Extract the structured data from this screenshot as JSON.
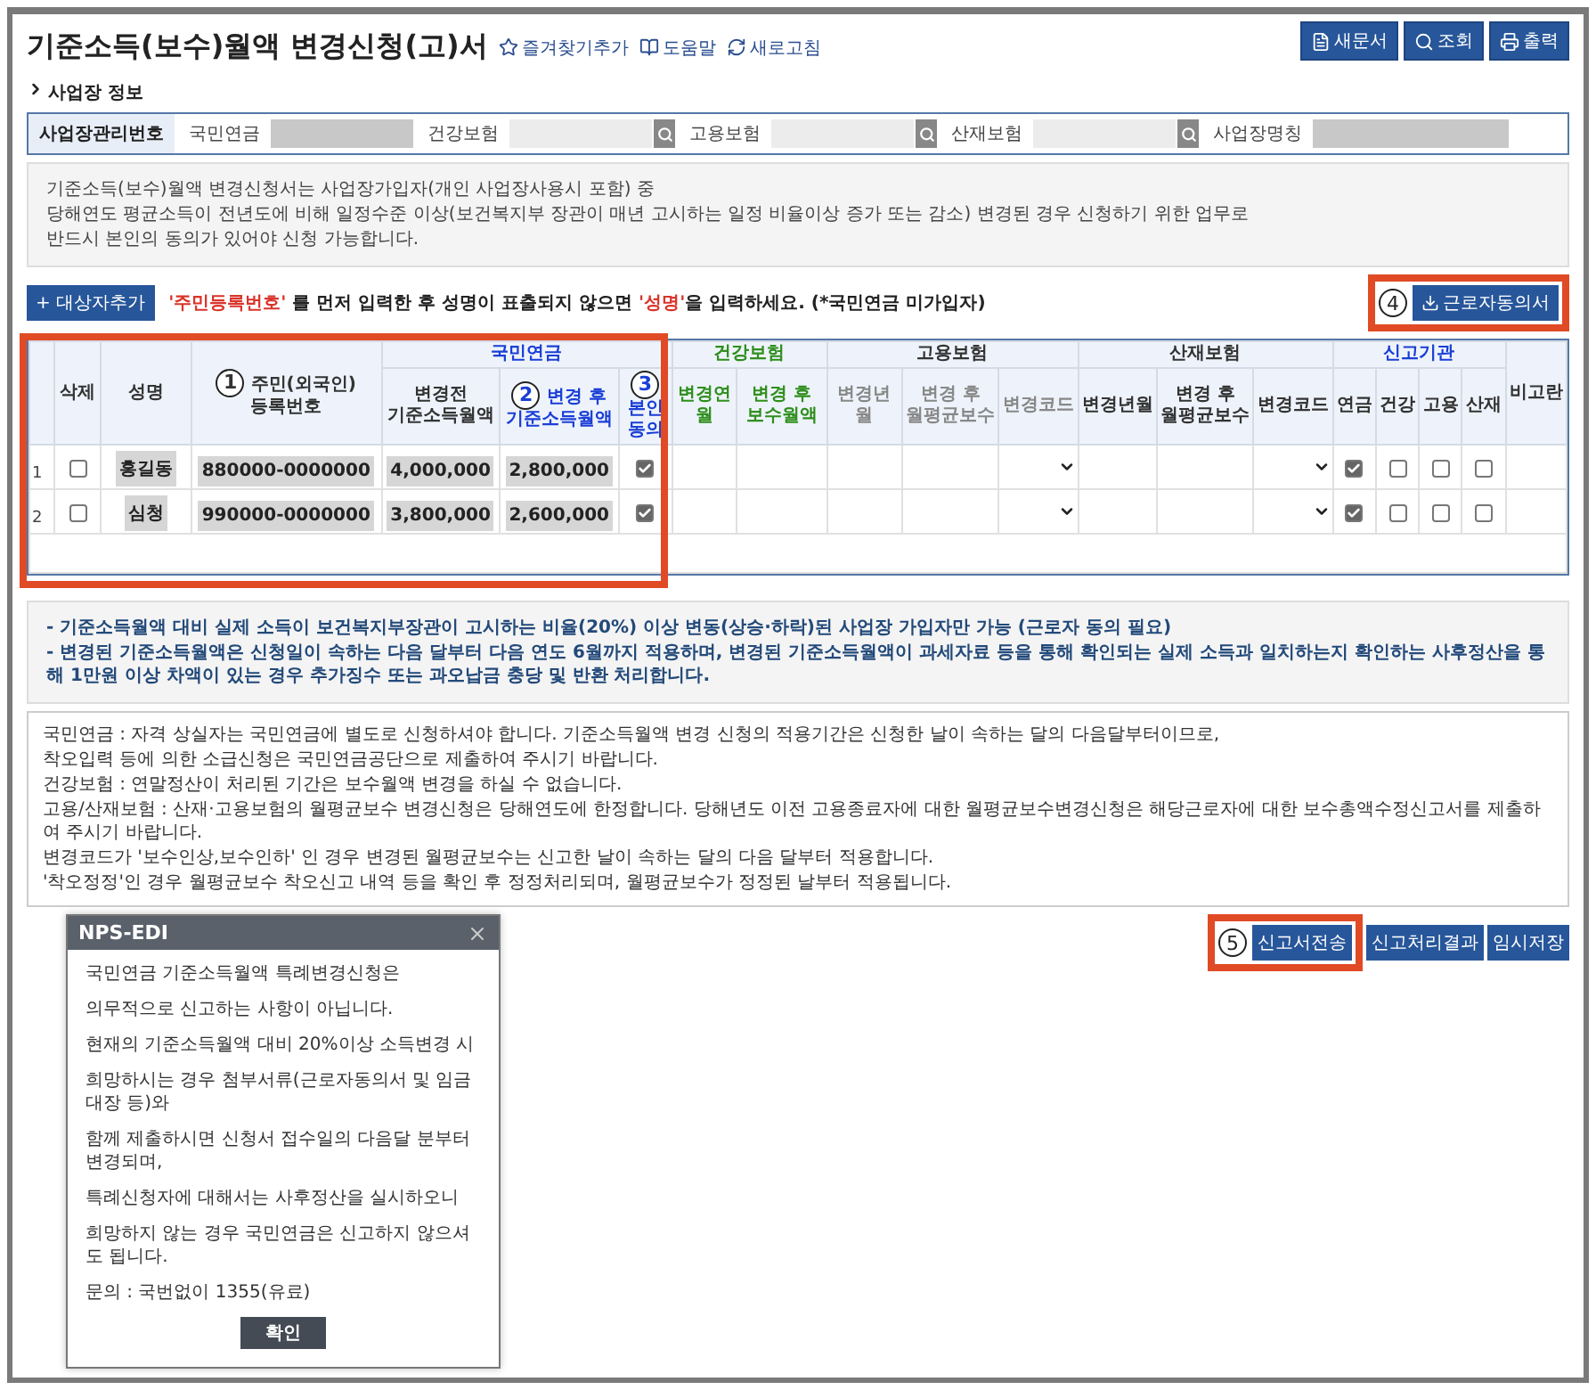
{
  "title": "기준소득(보수)월액 변경신청(고)서",
  "header_links": [
    {
      "label": "즐겨찾기추가",
      "kind": "star"
    },
    {
      "label": "도움말",
      "kind": "help"
    },
    {
      "label": "새로고침",
      "kind": "refresh"
    }
  ],
  "top_buttons": [
    {
      "label": "새문서",
      "kind": "new"
    },
    {
      "label": "조회",
      "kind": "search"
    },
    {
      "label": "출력",
      "kind": "print"
    }
  ],
  "section_title": "사업장 정보",
  "business_info": {
    "label": "사업장관리번호",
    "fields": [
      {
        "label": "국민연금",
        "kind": "plain"
      },
      {
        "label": "건강보험",
        "kind": "search"
      },
      {
        "label": "고용보험",
        "kind": "search"
      },
      {
        "label": "산재보험",
        "kind": "search"
      },
      {
        "label": "사업장명칭",
        "kind": "plain"
      }
    ]
  },
  "intro_lines": [
    "기준소득(보수)월액 변경신청서는 사업장가입자(개인 사업장사용시 포함) 중",
    "당해연도 평균소득이 전년도에 비해 일정수준 이상(보건복지부 장관이 매년 고시하는 일정 비율이상 증가 또는 감소) 변경된 경우 신청하기 위한 업무로",
    "반드시 본인의 동의가 있어야 신청 가능합니다."
  ],
  "add_button": "+ 대상자추가",
  "instruction": "**'주민등록번호'** 를 먼저 입력한 후 성명이 표출되지 않으면 **'성명'**을 입력하세요. (*국민연금 미가입자)",
  "consent_button": {
    "label": "근로자동의서",
    "marker": "4",
    "highlight": true
  },
  "table": {
    "highlight": true,
    "header": [
      {
        "kind": "fixed",
        "label": "삭제"
      },
      {
        "kind": "fixed",
        "label": "성명"
      },
      {
        "kind": "fixed",
        "label": "주민(외국인) 등록번호",
        "marker": "1"
      },
      {
        "kind": "pension",
        "label": "국민연금",
        "columns": [
          {
            "label": "변경전 기준소득월액",
            "kind": "plain"
          },
          {
            "label": "변경 후 기준소득월액",
            "kind": "blue",
            "marker": "2"
          },
          {
            "label": "본인 동의",
            "kind": "blue",
            "marker": "3"
          }
        ]
      },
      {
        "kind": "health",
        "label": "건강보험",
        "columns": [
          {
            "label": "변경연월",
            "kind": "green"
          },
          {
            "label": "변경 후 보수월액",
            "kind": "green"
          }
        ]
      },
      {
        "kind": "plain",
        "label": "고용보험",
        "columns": [
          {
            "label": "변경년월",
            "kind": "muted"
          },
          {
            "label": "변경 후 월평균보수",
            "kind": "muted"
          },
          {
            "label": "변경코드",
            "kind": "muted"
          }
        ]
      },
      {
        "kind": "plain",
        "label": "산재보험",
        "columns": [
          {
            "label": "변경년월",
            "kind": "plain"
          },
          {
            "label": "변경 후 월평균보수",
            "kind": "plain"
          },
          {
            "label": "변경코드",
            "kind": "plain"
          }
        ]
      },
      {
        "kind": "agency",
        "label": "신고기관",
        "columns": [
          {
            "label": "연금",
            "kind": "plain"
          },
          {
            "label": "건강",
            "kind": "plain"
          },
          {
            "label": "고용",
            "kind": "plain"
          },
          {
            "label": "산재",
            "kind": "plain"
          }
        ]
      },
      {
        "kind": "fixed",
        "label": "비고란"
      }
    ],
    "rows": [
      {
        "index": "1",
        "delete": false,
        "name": "홍길동",
        "rrn": "880000-0000000",
        "before": "4,000,000",
        "after": "2,800,000",
        "consent": true,
        "agencies": [
          true,
          false,
          false,
          false
        ]
      },
      {
        "index": "2",
        "delete": false,
        "name": "심청",
        "rrn": "990000-0000000",
        "before": "3,800,000",
        "after": "2,600,000",
        "consent": true,
        "agencies": [
          true,
          false,
          false,
          false
        ]
      }
    ]
  },
  "notices": [
    "- 기준소득월액 대비 실제 소득이 보건복지부장관이 고시하는 비율(20%) 이상 변동(상승·하락)된 사업장 가입자만 가능 (근로자 동의 필요)",
    "- 변경된 기준소득월액은 신청일이 속하는 다음 달부터 다음 연도 6월까지 적용하며, 변경된 기준소득월액이 과세자료 등을 통해 확인되는 실제 소득과 일치하는지 확인하는 사후정산을 통해 1만원 이상 차액이 있는 경우 추가징수 또는 과오납금 충당 및 반환 처리합니다."
  ],
  "guide_lines": [
    "국민연금 : 자격 상실자는 국민연금에 별도로 신청하셔야 합니다. 기준소득월액 변경 신청의 적용기간은 신청한 날이 속하는 달의 다음달부터이므로,",
    "착오입력 등에 의한 소급신청은 국민연금공단으로 제출하여 주시기 바랍니다.",
    "건강보험 : 연말정산이 처리된 기간은 보수월액 변경을 하실 수 없습니다.",
    "고용/산재보험 : 산재·고용보험의 월평균보수 변경신청은 당해연도에 한정합니다. 당해년도 이전 고용종료자에 대한 월평균보수변경신청은 해당근로자에 대한 보수총액수정신고서를 제출하여 주시기 바랍니다.",
    "변경코드가 '보수인상,보수인하' 인 경우 변경된 월평균보수는 신고한 날이 속하는 달의 다음 달부터 적용합니다.",
    "'착오정정'인 경우 월평균보수 착오신고 내역 등을 확인 후 정정처리되며, 월평균보수가 정정된 날부터 적용됩니다."
  ],
  "send_button": {
    "label": "신고서전송",
    "marker": "5",
    "highlight": true
  },
  "bottom_buttons": [
    "신고처리결과",
    "임시저장"
  ],
  "dialog": {
    "title": "NPS-EDI",
    "paragraphs": [
      "국민연금 기준소득월액 특례변경신청은",
      "의무적으로 신고하는 사항이 아닙니다.",
      "현재의 기준소득월액 대비 20%이상 소득변경 시",
      "희망하시는 경우 첨부서류(근로자동의서 및 임금대장 등)와",
      "함께 제출하시면 신청서 접수일의 다음달 분부터 변경되며,",
      "특례신청자에 대해서는 사후정산을 실시하오니",
      "희망하지 않는 경우 국민연금은 신고하지 않으셔도 됩니다.",
      "문의 : 국번없이 1355(유료)"
    ],
    "ok_button": "확인"
  }
}
